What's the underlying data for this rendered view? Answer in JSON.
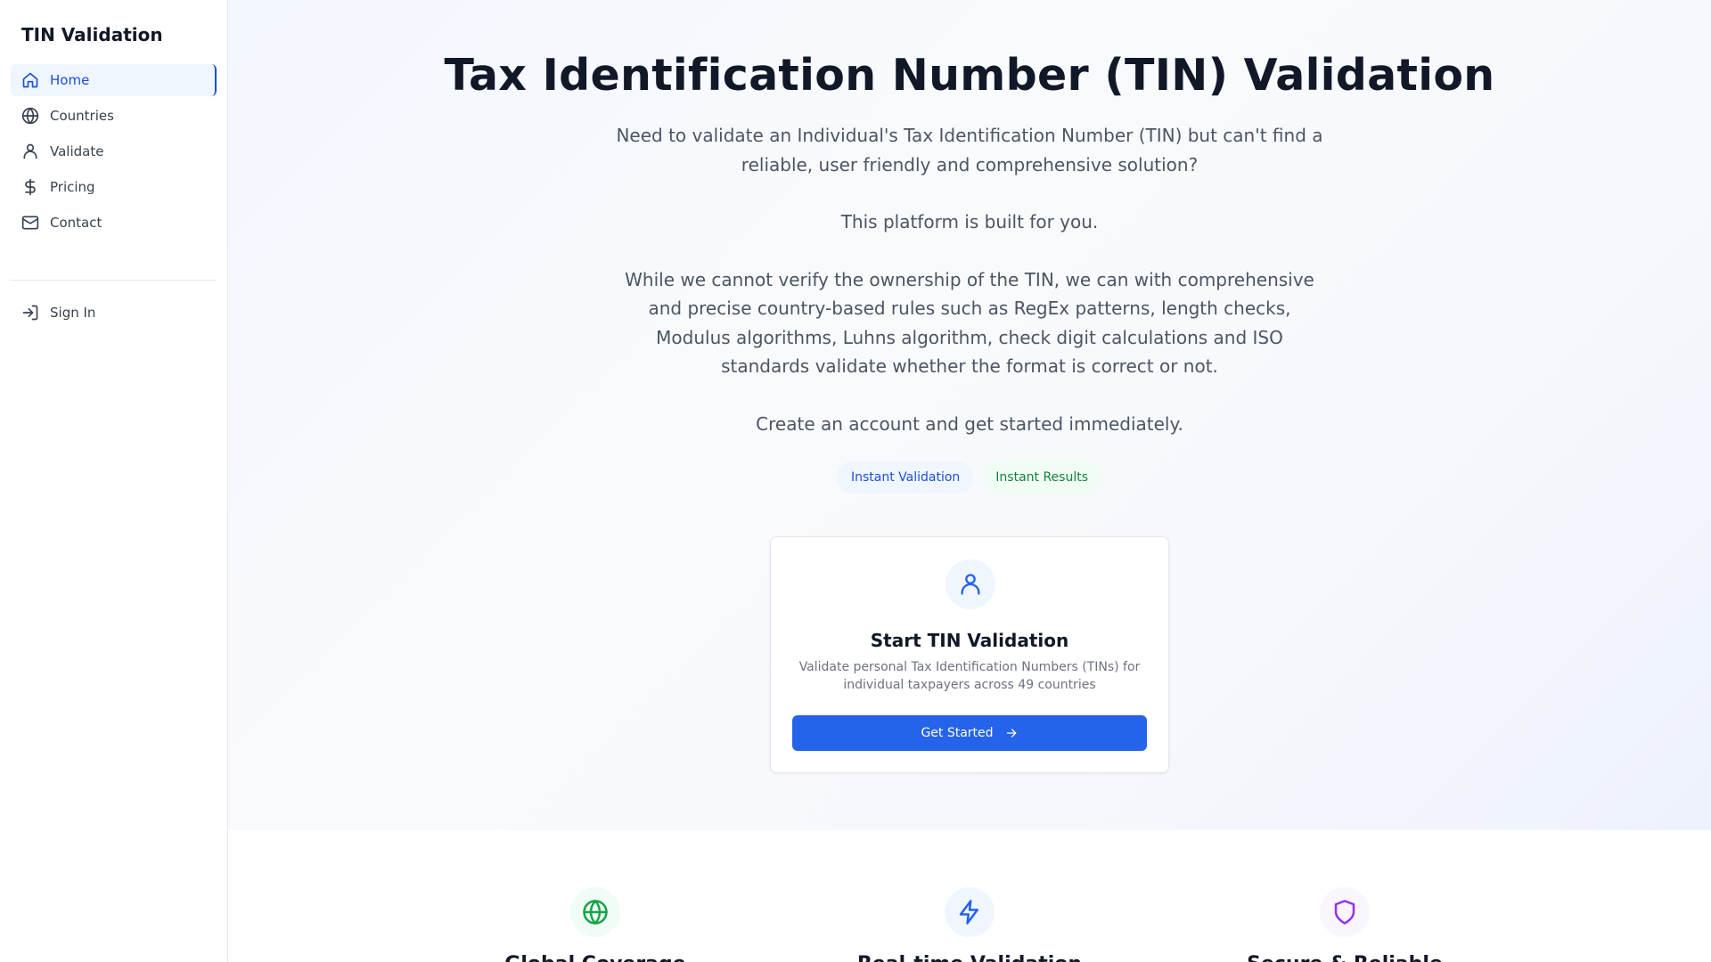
{
  "sidebar": {
    "brand": "TIN Validation",
    "items": [
      {
        "label": "Home"
      },
      {
        "label": "Countries"
      },
      {
        "label": "Validate"
      },
      {
        "label": "Pricing"
      },
      {
        "label": "Contact"
      }
    ],
    "sign_in": "Sign In"
  },
  "hero": {
    "title": "Tax Identification Number (TIN) Validation",
    "paragraphs": [
      "Need to validate an Individual's Tax Identification Number (TIN) but can't find a reliable, user friendly and comprehensive solution?",
      "This platform is built for you.",
      "While we cannot verify the ownership of the TIN, we can with comprehensive and precise country-based rules such as RegEx patterns, length checks, Modulus algorithms, Luhns algorithm, check digit calculations and ISO standards validate whether the format is correct or not.",
      "Create an account and get started immediately."
    ],
    "badges": [
      "Instant Validation",
      "Instant Results"
    ]
  },
  "card": {
    "icon": "user-icon",
    "title": "Start TIN Validation",
    "description": "Validate personal Tax Identification Numbers (TINs) for individual taxpayers across 49 countries",
    "button": "Get Started"
  },
  "features": [
    {
      "icon": "globe-icon",
      "title": "Global Coverage",
      "color": "#16a34a"
    },
    {
      "icon": "zap-icon",
      "title": "Real-time Validation",
      "color": "#2563eb"
    },
    {
      "icon": "shield-icon",
      "title": "Secure & Reliable",
      "color": "#9333ea"
    }
  ],
  "colors": {
    "accent": "#2563eb",
    "active_nav": "#1d4ed8",
    "badge_green": "#15803d"
  }
}
